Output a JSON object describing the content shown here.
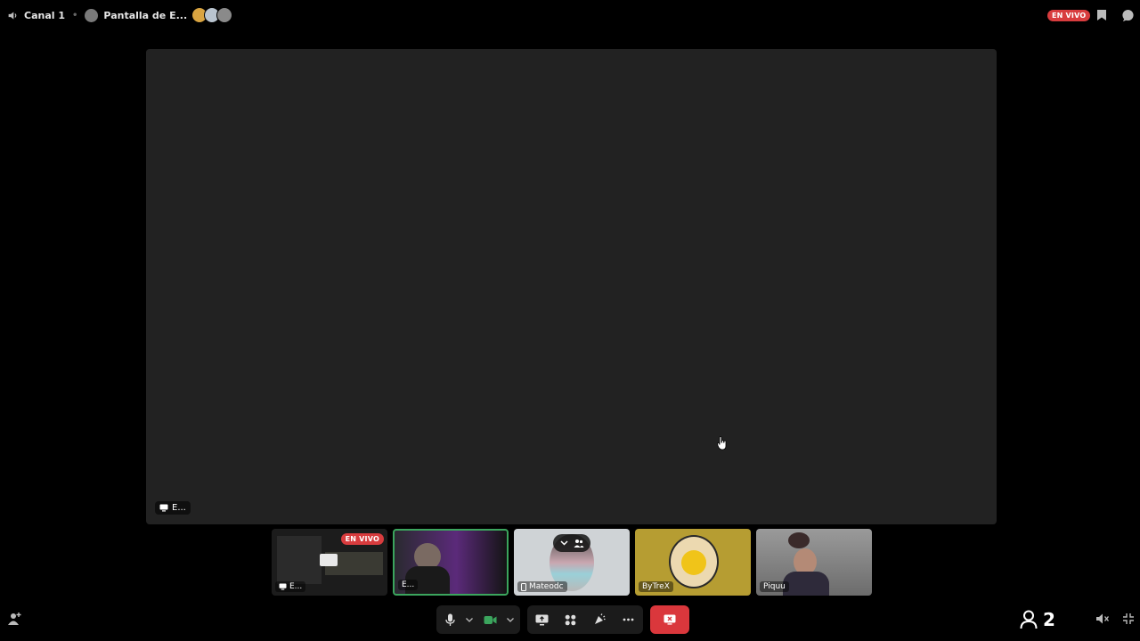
{
  "topbar": {
    "channel": "Canal 1",
    "stream_title": "Pantalla de E...",
    "live_badge": "EN VIVO"
  },
  "stage": {
    "tag_label": "E..."
  },
  "tiles": [
    {
      "label": "E...",
      "live_badge": "EN VIVO"
    },
    {
      "label": "E..."
    },
    {
      "label": "Mateodc"
    },
    {
      "label": "ByTreX"
    },
    {
      "label": "Piquu"
    }
  ],
  "footer": {
    "viewer_count": "2"
  },
  "colors": {
    "live_red": "#d83c3e",
    "speaking_green": "#3ba55d",
    "end_call_red": "#da373c",
    "stage_bg": "#222222",
    "control_bg": "#1b1b1b"
  },
  "icons": [
    "speaker-icon",
    "bookmark-icon",
    "chat-bubble-icon",
    "microphone-icon",
    "camera-icon",
    "screen-share-icon",
    "activities-icon",
    "soundboard-icon",
    "more-icon",
    "leave-call-icon",
    "add-person-icon",
    "person-icon",
    "mute-icon",
    "minimize-icon"
  ]
}
